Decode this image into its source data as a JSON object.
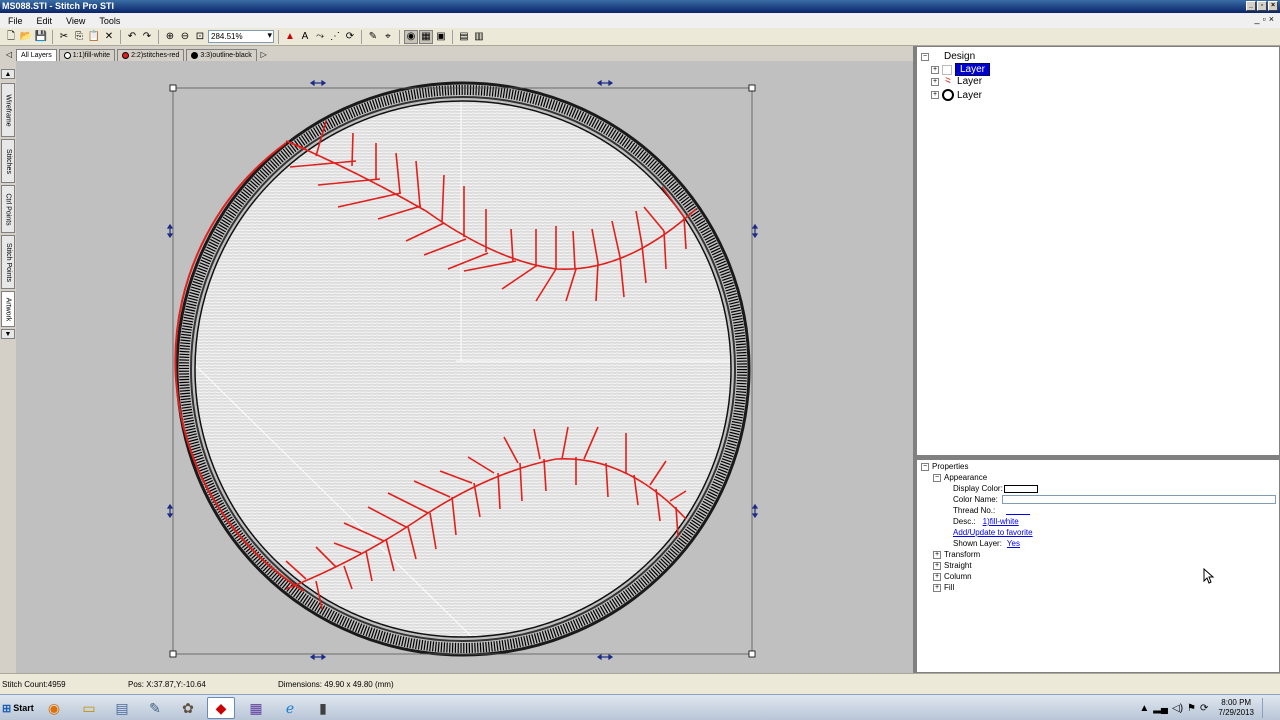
{
  "window": {
    "title": "MS088.STI - Stitch Pro STI"
  },
  "menu": [
    "File",
    "Edit",
    "View",
    "Tools"
  ],
  "toolbar": {
    "zoom_value": "284.51%"
  },
  "layer_tabs": [
    {
      "label": "All Layers",
      "active": true
    },
    {
      "label": "1:1)fill-white",
      "color": "#ffffff"
    },
    {
      "label": "2:2)stitches-red",
      "color": "#e0201c"
    },
    {
      "label": "3:3)outline-black",
      "color": "#000000"
    }
  ],
  "side_tabs": [
    "Wireframe",
    "Stitches",
    "Ctrl Points",
    "Stitch Points",
    "Artwork"
  ],
  "tree": {
    "root": "Design",
    "layers": [
      {
        "label": "Layer",
        "selected": true
      },
      {
        "label": "Layer",
        "icon": "red-stitch-icon"
      },
      {
        "label": "Layer",
        "icon": "black-circle-icon"
      }
    ]
  },
  "properties": {
    "title": "Properties",
    "appearance": {
      "label": "Appearance",
      "display_color_label": "Display Color:",
      "display_color": "#ffffff",
      "color_name_label": "Color Name:",
      "color_name_value": "",
      "thread_no_label": "Thread No.:",
      "thread_no_value": "",
      "desc_label": "Desc.:",
      "desc_value": "1)fill-white",
      "favorite_link": "Add/Update to favorite",
      "shown_layer_label": "Shown Layer:",
      "shown_layer_value": "Yes"
    },
    "groups": [
      "Transform",
      "Straight",
      "Column",
      "Fill"
    ]
  },
  "status": {
    "stitch_count": "Stitch Count:4959",
    "pos": "Pos:  X:37.87,Y:-10.64",
    "dimensions": "Dimensions: 49.90 x 49.80 (mm)"
  },
  "taskbar": {
    "start_label": "Start",
    "time": "8:00 PM",
    "date": "7/29/2013"
  },
  "colors": {
    "selection_blue": "#0000cc",
    "stitch_red": "#e0201c"
  }
}
